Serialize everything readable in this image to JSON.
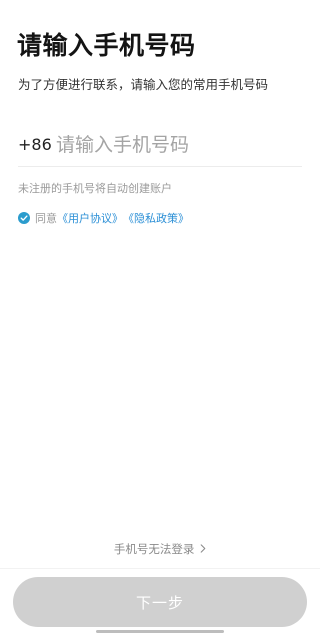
{
  "header": {
    "title": "请输入手机号码",
    "subtitle": "为了方便进行联系，请输入您的常用手机号码"
  },
  "phone": {
    "country_code": "+86",
    "value": "",
    "placeholder": "请输入手机号码"
  },
  "hint": "未注册的手机号将自动创建账户",
  "agreement": {
    "checked": true,
    "prefix": "同意",
    "user_agreement": "《用户协议》",
    "privacy_policy": "《隐私政策》"
  },
  "footer": {
    "cannot_login": "手机号无法登录",
    "next_button": "下一步"
  },
  "colors": {
    "accent": "#2b9ccd",
    "link": "#2b8fd6",
    "button_disabled": "#d0d0d0"
  },
  "icons": {
    "agreement_check": "check-circle-icon",
    "cannot_login_arrow": "chevron-right-icon"
  }
}
